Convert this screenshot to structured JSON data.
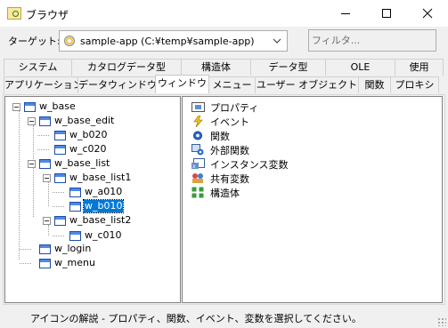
{
  "window": {
    "title": "ブラウザ",
    "icon": "browser-app-icon",
    "controls": [
      "minimize-icon",
      "maximize-icon",
      "close-icon"
    ]
  },
  "target": {
    "label": "ターゲット:",
    "value": "sample-app (C:¥temp¥sample-app)",
    "icon": "target-library-icon"
  },
  "filter": {
    "placeholder": "フィルタ..."
  },
  "tabs": {
    "row1": [
      "システム",
      "カタログデータ型",
      "構造体",
      "データ型",
      "OLE",
      "使用"
    ],
    "row2": [
      "アプリケーション",
      "データウィンドウ",
      "ウィンドウ",
      "メニュー",
      "ユーザー オブジェクト",
      "関数",
      "プロキシ"
    ],
    "active": "ウィンドウ"
  },
  "tree": {
    "nodes": [
      "w_base",
      "w_base_edit",
      "w_b020",
      "w_c020",
      "w_base_list",
      "w_base_list1",
      "w_a010",
      "w_b010",
      "w_base_list2",
      "w_c010",
      "w_login",
      "w_menu"
    ],
    "selected": "w_b010"
  },
  "properties": [
    {
      "label": "プロパティ",
      "icon": "property-icon"
    },
    {
      "label": "イベント",
      "icon": "event-icon"
    },
    {
      "label": "関数",
      "icon": "function-icon"
    },
    {
      "label": "外部関数",
      "icon": "external-function-icon"
    },
    {
      "label": "インスタンス変数",
      "icon": "instance-variable-icon"
    },
    {
      "label": "共有変数",
      "icon": "shared-variable-icon"
    },
    {
      "label": "構造体",
      "icon": "structure-icon"
    }
  ],
  "status": {
    "text": "アイコンの解説 - プロパティ、関数、イベント、変数を選択してください。"
  },
  "colors": {
    "selection": "#0078d7",
    "window_icon": "#1e4fa8"
  }
}
